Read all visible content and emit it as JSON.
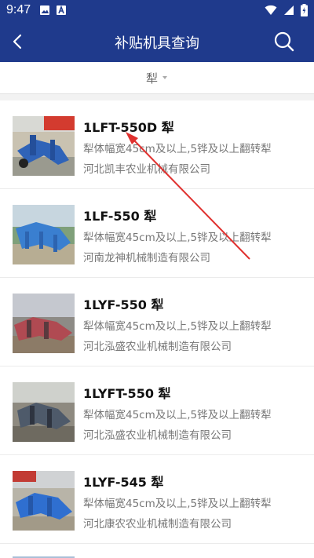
{
  "status_bar": {
    "time": "9:47"
  },
  "nav": {
    "title": "补贴机具查询"
  },
  "filter": {
    "selected": "犁"
  },
  "items": [
    {
      "title": "1LFT-550D 犁",
      "desc": "犁体幅宽45cm及以上,5铧及以上翻转犁",
      "company": "河北凯丰农业机械有限公司"
    },
    {
      "title": "1LF-550 犁",
      "desc": "犁体幅宽45cm及以上,5铧及以上翻转犁",
      "company": "河南龙神机械制造有限公司"
    },
    {
      "title": "1LYF-550 犁",
      "desc": "犁体幅宽45cm及以上,5铧及以上翻转犁",
      "company": "河北泓盛农业机械制造有限公司"
    },
    {
      "title": "1LYFT-550 犁",
      "desc": "犁体幅宽45cm及以上,5铧及以上翻转犁",
      "company": "河北泓盛农业机械制造有限公司"
    },
    {
      "title": "1LYF-545 犁",
      "desc": "犁体幅宽45cm及以上,5铧及以上翻转犁",
      "company": "河北康农农业机械制造有限公司"
    }
  ],
  "colors": {
    "header": "#1f3a8c",
    "annotation_arrow": "#e0312f"
  },
  "icons": [
    "image-icon",
    "a-badge-icon",
    "wifi-icon",
    "signal-icon",
    "battery-icon",
    "back-arrow-icon",
    "search-icon",
    "dropdown-caret-icon"
  ]
}
